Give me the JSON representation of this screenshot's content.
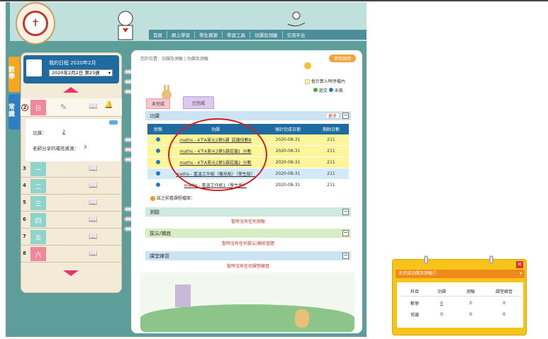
{
  "nav": {
    "items": [
      "首頁",
      "網上學習",
      "學生資源",
      "學習工具",
      "功課及測驗",
      "交流平台"
    ]
  },
  "side_tabs": [
    {
      "label": "數學",
      "color": "#f5a623"
    },
    {
      "label": "常識",
      "color": "#2e7dc5"
    }
  ],
  "calendar": {
    "title": "我的日程 2020年2月",
    "week_select": "2020年2月2日 第23週",
    "days": [
      {
        "num": "2",
        "name": "日",
        "color": "#f0879b"
      },
      {
        "num": "3",
        "name": "一",
        "color": "#8fd4cc"
      },
      {
        "num": "4",
        "name": "二",
        "color": "#8fd4cc"
      },
      {
        "num": "5",
        "name": "三",
        "color": "#8fd4cc"
      },
      {
        "num": "6",
        "name": "四",
        "color": "#8fd4cc"
      },
      {
        "num": "7",
        "name": "五",
        "color": "#8fd4cc"
      },
      {
        "num": "8",
        "name": "六",
        "color": "#f0879b"
      }
    ],
    "detail": {
      "homework_label": "功課：",
      "homework_value": "2",
      "teacher_label": "老師分享的補充資源：",
      "teacher_value": "3"
    }
  },
  "breadcrumb": {
    "prefix": "您的位置：",
    "path1": "功課及測驗",
    "sep": " | ",
    "path2": "功課及測驗"
  },
  "help_badge": "使用說明",
  "legend": {
    "include": "會計算入時序檔內",
    "submitted": "遞交",
    "not_submitted": "未做"
  },
  "tabs": {
    "incomplete": "未完成",
    "complete": "已完成"
  },
  "homework": {
    "section_title": "功課",
    "more": "更多",
    "headers": [
      "狀態",
      "功課",
      "預計完成日期",
      "剩餘日數"
    ],
    "rows": [
      {
        "title": "maths - 4下A單元2第5課_認識倍數B",
        "date": "2020-08-31",
        "days": "211",
        "style": "ylw"
      },
      {
        "title": "maths - 4下A單元2第5課認識1_分數",
        "date": "2020-08-31",
        "days": "211",
        "style": "ylw"
      },
      {
        "title": "maths - 4下A單元2第5課認識2_分數",
        "date": "2020-08-31",
        "days": "211",
        "style": "ylw"
      },
      {
        "title": "maths - 重溫工作紙（備充紙）（學生版）",
        "date": "2020-08-31",
        "days": "211",
        "style": "blu"
      },
      {
        "title": "maths - 重溫工作紙1（學生版）",
        "date": "2020-08-31",
        "days": "211",
        "style": "wht"
      }
    ],
    "note": "該之前看課程檔案："
  },
  "sections": [
    {
      "title": "測驗",
      "empty": "暫時沒有任何測驗",
      "color": "#cde9e0"
    },
    {
      "title": "拔尖/補底",
      "empty": "暫時沒有任何拔尖/補底習題",
      "color": "#d9edc4"
    },
    {
      "title": "課堂練習",
      "empty": "暫時沒有任何課堂練習",
      "color": "#cbe3f2"
    }
  ],
  "popup": {
    "title": "未完成功課及測驗Ⓒ",
    "headers": [
      "科目",
      "功課",
      "測驗",
      "課堂練習"
    ],
    "rows": [
      [
        "數學",
        "6",
        "0",
        "0"
      ],
      [
        "常識",
        "0",
        "0",
        "0"
      ]
    ]
  }
}
